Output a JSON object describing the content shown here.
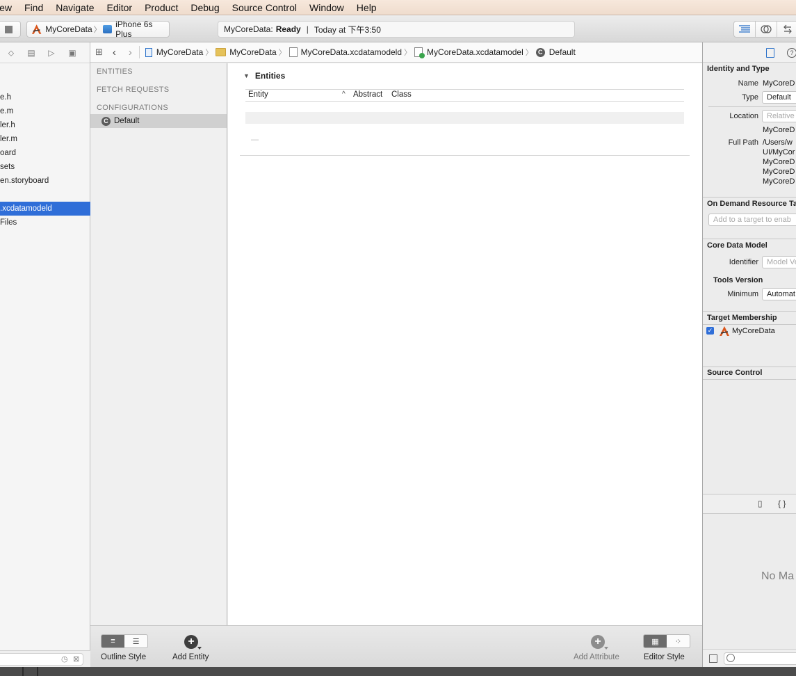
{
  "menubar": {
    "items": [
      "iew",
      "Find",
      "Navigate",
      "Editor",
      "Product",
      "Debug",
      "Source Control",
      "Window",
      "Help"
    ]
  },
  "toolbar": {
    "scheme_name": "MyCoreData",
    "device_name": "iPhone 6s Plus",
    "activity_project": "MyCoreData:",
    "activity_status": "Ready",
    "activity_time": "Today at 下午3:50"
  },
  "navigator": {
    "items": [
      {
        "label": "e.h",
        "selected": false
      },
      {
        "label": "e.m",
        "selected": false
      },
      {
        "label": "ler.h",
        "selected": false
      },
      {
        "label": "ler.m",
        "selected": false
      },
      {
        "label": "oard",
        "selected": false
      },
      {
        "label": "sets",
        "selected": false
      },
      {
        "label": "en.storyboard",
        "selected": false
      },
      {
        "label": ".xcdatamodeld",
        "selected": true
      },
      {
        "label": "Files",
        "selected": false
      }
    ]
  },
  "jumpbar": {
    "crumbs": [
      "MyCoreData",
      "MyCoreData",
      "MyCoreData.xcdatamodeld",
      "MyCoreData.xcdatamodel",
      "Default"
    ]
  },
  "outline": {
    "sections": [
      "ENTITIES",
      "FETCH REQUESTS",
      "CONFIGURATIONS"
    ],
    "configuration_item": "Default",
    "configuration_badge": "C"
  },
  "editor": {
    "section_title": "Entities",
    "columns": [
      "Entity",
      "Abstract",
      "Class"
    ],
    "placeholder_dash": "—"
  },
  "editor_bottom": {
    "outline_style_label": "Outline Style",
    "add_entity_label": "Add Entity",
    "add_attribute_label": "Add Attribute",
    "editor_style_label": "Editor Style"
  },
  "inspector": {
    "identity_header": "Identity and Type",
    "name_label": "Name",
    "name_value": "MyCoreD",
    "type_label": "Type",
    "type_value": "Default",
    "location_label": "Location",
    "location_value": "Relative",
    "location_path": "MyCoreD",
    "full_path_label": "Full Path",
    "full_path_lines": [
      "/Users/w",
      "UI/MyCor",
      "MyCoreD",
      "MyCoreD",
      "MyCoreD"
    ],
    "odr_header": "On Demand Resource Tag",
    "odr_placeholder": "Add to a target to enab",
    "core_data_header": "Core Data Model",
    "identifier_label": "Identifier",
    "identifier_placeholder": "Model Ve",
    "tools_version_header": "Tools Version",
    "minimum_label": "Minimum",
    "minimum_value": "Automat",
    "target_header": "Target Membership",
    "target_name": "MyCoreData",
    "source_control_header": "Source Control",
    "no_matches": "No Ma"
  }
}
